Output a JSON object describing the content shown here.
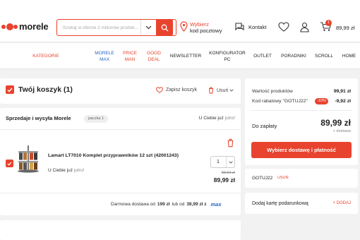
{
  "brand": {
    "name": "morele",
    "color": "#e8432e"
  },
  "search": {
    "placeholder": "Szukaj w ofercie 2 milionów produk..."
  },
  "location": {
    "line1": "Wybierz",
    "line2": "kod pocztowy"
  },
  "contact": {
    "label": "Kontakt"
  },
  "header_cart": {
    "count": "1",
    "price": "89,99 zł"
  },
  "nav": [
    {
      "label": "KATEGORIE"
    },
    {
      "label": "MORELE\nMAX"
    },
    {
      "label": "PRICE\nMAN"
    },
    {
      "label": "GOOD\nDEAL"
    },
    {
      "label": "NEWSLETTER"
    },
    {
      "label": "KONFIGURATOR\nPC"
    },
    {
      "label": "OUTLET"
    },
    {
      "label": "PORADNIKI"
    },
    {
      "label": "SCROLL"
    },
    {
      "label": "HOME"
    }
  ],
  "cart": {
    "title": "Twój koszyk (1)",
    "save_label": "Zapisz koszyk",
    "delete_label": "Usuń",
    "seller": "Sprzedaje i wysyła Morele",
    "package": "paczka 1",
    "arrival_prefix": "U Ciebie już",
    "arrival_day": "jutro!",
    "product": {
      "name": "Lamart LT7010 Komplet przyprawników 12 szt (42001243)",
      "availability_prefix": "U Ciebie już",
      "availability_day": "jutro!",
      "quantity": "1",
      "old_price": "99,91 zł",
      "price": "89,99 zł"
    },
    "delivery": {
      "prefix": "Darmowa dostawa od",
      "threshold": "199 zł",
      "middle": "lub od",
      "max_threshold": "39,99 zł z",
      "max_label": "max"
    }
  },
  "summary": {
    "products_label": "Wartość produktów",
    "products_value": "99,91 zł",
    "discount_label": "Kod rabatowy \"GOTUJ22\"",
    "discount_badge": "-10%",
    "discount_value": "-9,92 zł",
    "to_pay_label": "Do zapłaty",
    "to_pay_value": "89,99 zł",
    "to_pay_note": "+ dostawa",
    "button_label": "Wybierz dostawę i płatność",
    "code": "GOTUJ22",
    "code_delete": "USUŃ",
    "gift_label": "Dodaj kartę podarunkową",
    "gift_add": "+ DODAJ"
  }
}
